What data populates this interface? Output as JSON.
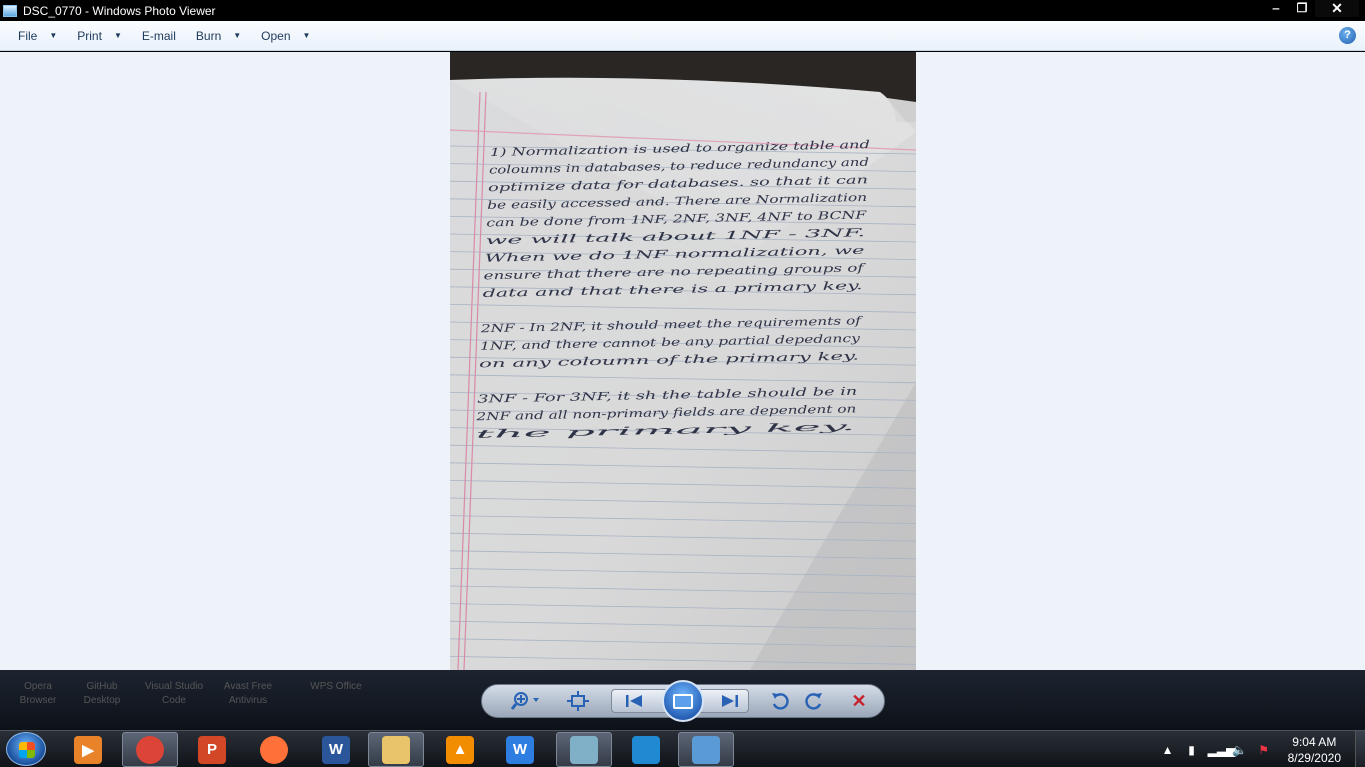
{
  "window": {
    "title": "DSC_0770 - Windows Photo Viewer",
    "help_label": "?"
  },
  "menubar": {
    "items": [
      {
        "label": "File",
        "has_arrow": true
      },
      {
        "label": "Print",
        "has_arrow": true
      },
      {
        "label": "E-mail",
        "has_arrow": false
      },
      {
        "label": "Burn",
        "has_arrow": true
      },
      {
        "label": "Open",
        "has_arrow": true
      }
    ]
  },
  "photo": {
    "handwriting_lines": [
      "1) Normalization is used to organize table and",
      "coloumns in databases, to reduce redundancy and",
      "optimize data for databases. so that it can",
      "be easily accessed and. There are Normalization",
      "can be done from 1NF, 2NF, 3NF, 4NF to BCNF",
      "we will talk about 1NF - 3NF.",
      "When we do 1NF normalization, we",
      "ensure that there are no repeating groups of",
      "data and that there is a primary key.",
      "",
      "2NF - In 2NF, it should meet the requirements of",
      "1NF, and there cannot be any partial depedancy",
      "on any coloumn of the primary key.",
      "",
      "3NF - For 3NF, it sh the table should be in",
      "2NF and all non-primary fields are dependent on",
      "the primary key."
    ]
  },
  "controls": {
    "ghost_labels": [
      "Opera Browser",
      "GitHub Desktop",
      "Visual Studio Code",
      "Avast Free Antivirus",
      "WPS Office"
    ]
  },
  "taskbar": {
    "apps": [
      {
        "name": "windows-media-player",
        "glyph": "▶",
        "color": "#e8832a"
      },
      {
        "name": "chrome",
        "glyph": "",
        "color": "#db4437"
      },
      {
        "name": "powerpoint",
        "glyph": "P",
        "color": "#d24726"
      },
      {
        "name": "firefox",
        "glyph": "",
        "color": "#ff7139"
      },
      {
        "name": "word",
        "glyph": "W",
        "color": "#2b579a"
      },
      {
        "name": "file-explorer",
        "glyph": "",
        "color": "#e9c46a"
      },
      {
        "name": "vlc",
        "glyph": "▲",
        "color": "#f28c00"
      },
      {
        "name": "wps-office",
        "glyph": "W",
        "color": "#2e7de1"
      },
      {
        "name": "notes",
        "glyph": "",
        "color": "#7fb0c8"
      },
      {
        "name": "vscode",
        "glyph": "",
        "color": "#1f8ad2"
      },
      {
        "name": "photo-viewer",
        "glyph": "",
        "color": "#5b9bd5"
      }
    ],
    "clock_time": "9:04 AM",
    "clock_date": "8/29/2020"
  }
}
